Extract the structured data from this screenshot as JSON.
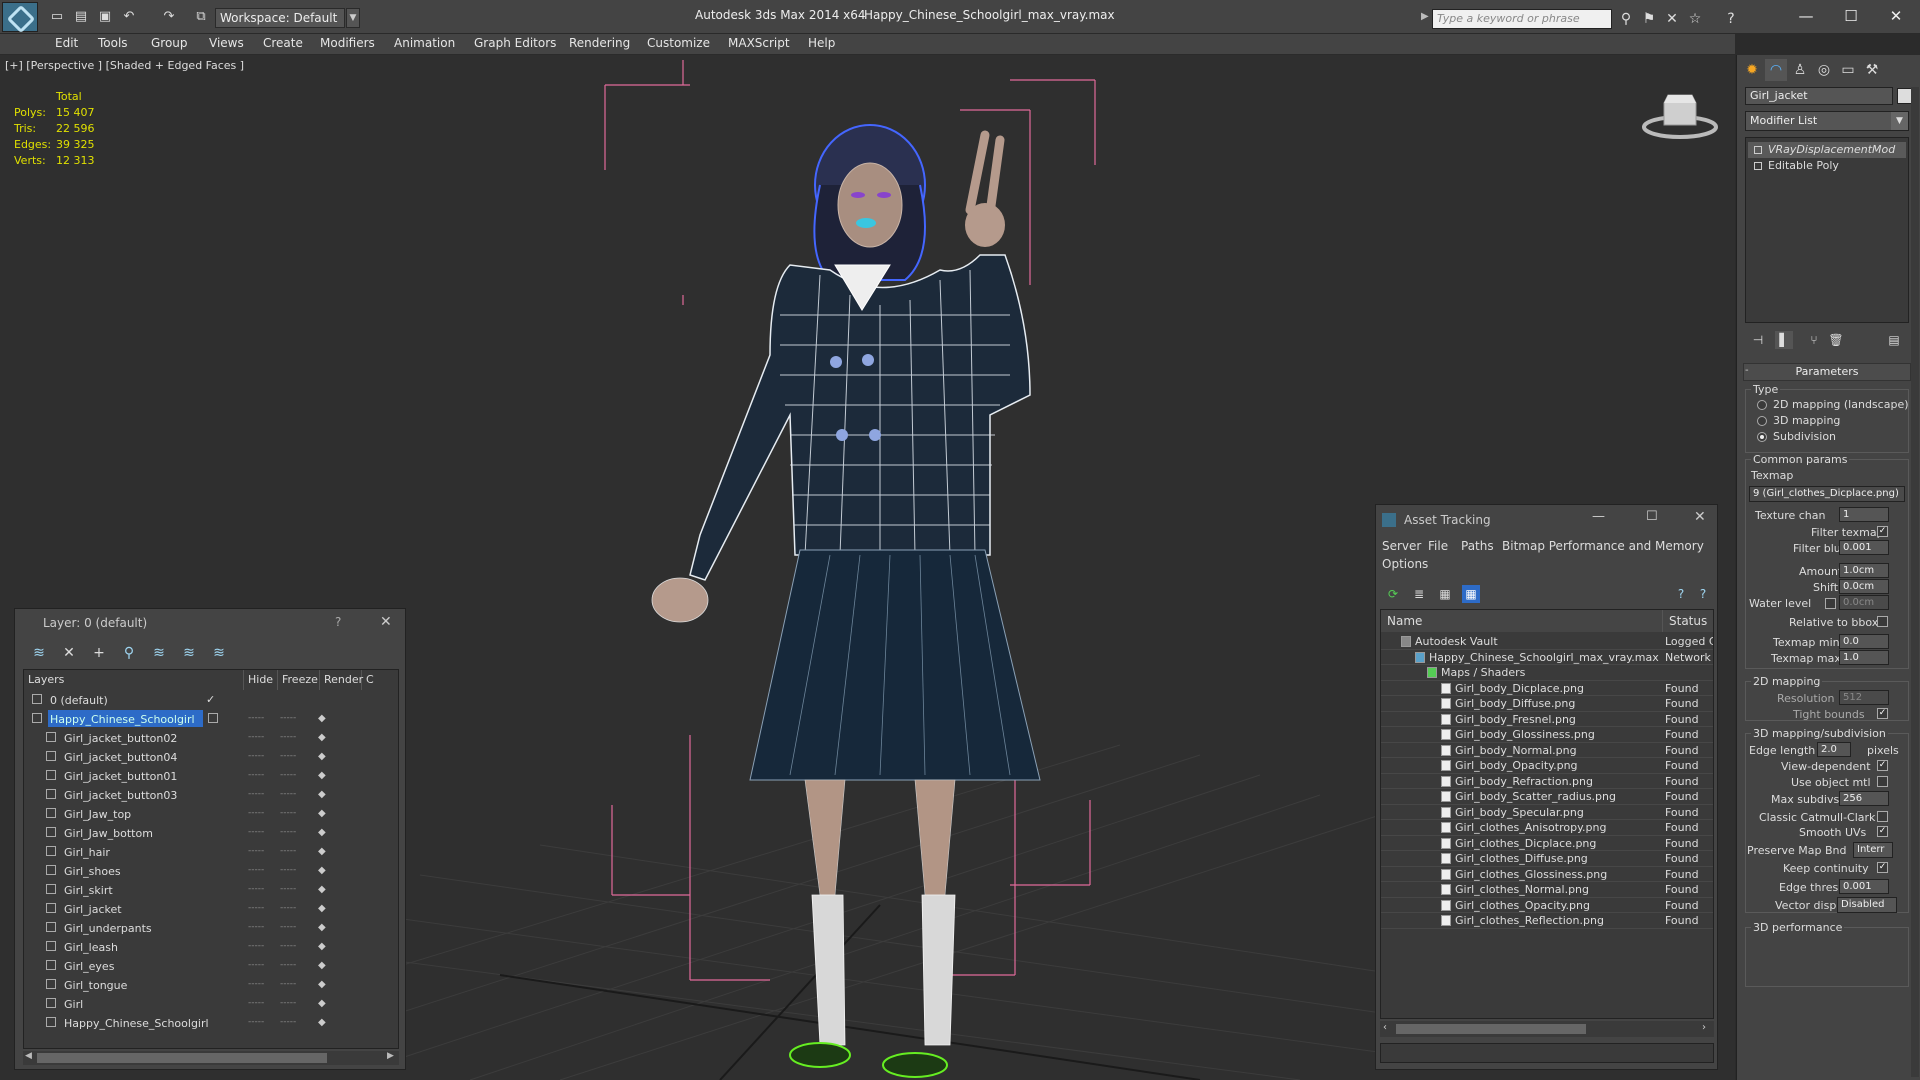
{
  "titlebar": {
    "app_title": "Autodesk 3ds Max  2014 x64",
    "file_title": "Happy_Chinese_Schoolgirl_max_vray.max",
    "workspace": "Workspace: Default",
    "search_placeholder": "Type a keyword or phrase"
  },
  "menu": [
    "Edit",
    "Tools",
    "Group",
    "Views",
    "Create",
    "Modifiers",
    "Animation",
    "Graph Editors",
    "Rendering",
    "Customize",
    "MAXScript",
    "Help"
  ],
  "viewport": {
    "label": "[+] [Perspective ] [Shaded + Edged Faces ]",
    "stats": {
      "header": "Total",
      "rows": [
        {
          "label": "Polys:",
          "value": "15 407"
        },
        {
          "label": "Tris:",
          "value": "22 596"
        },
        {
          "label": "Edges:",
          "value": "39 325"
        },
        {
          "label": "Verts:",
          "value": "12 313"
        }
      ]
    }
  },
  "layer_window": {
    "title": "Layer: 0 (default)",
    "help": "?",
    "columns": [
      "Layers",
      "Hide",
      "Freeze",
      "Render",
      "C"
    ],
    "rows": [
      {
        "name": "0 (default)",
        "level": 0,
        "active": true,
        "selected": false
      },
      {
        "name": "Happy_Chinese_Schoolgirl",
        "level": 0,
        "active": false,
        "selected": true
      },
      {
        "name": "Girl_jacket_button02",
        "level": 1,
        "active": false,
        "selected": false
      },
      {
        "name": "Girl_jacket_button04",
        "level": 1,
        "active": false,
        "selected": false
      },
      {
        "name": "Girl_jacket_button01",
        "level": 1,
        "active": false,
        "selected": false
      },
      {
        "name": "Girl_jacket_button03",
        "level": 1,
        "active": false,
        "selected": false
      },
      {
        "name": "Girl_Jaw_top",
        "level": 1,
        "active": false,
        "selected": false
      },
      {
        "name": "Girl_Jaw_bottom",
        "level": 1,
        "active": false,
        "selected": false
      },
      {
        "name": "Girl_hair",
        "level": 1,
        "active": false,
        "selected": false
      },
      {
        "name": "Girl_shoes",
        "level": 1,
        "active": false,
        "selected": false
      },
      {
        "name": "Girl_skirt",
        "level": 1,
        "active": false,
        "selected": false
      },
      {
        "name": "Girl_jacket",
        "level": 1,
        "active": false,
        "selected": false
      },
      {
        "name": "Girl_underpants",
        "level": 1,
        "active": false,
        "selected": false
      },
      {
        "name": "Girl_leash",
        "level": 1,
        "active": false,
        "selected": false
      },
      {
        "name": "Girl_eyes",
        "level": 1,
        "active": false,
        "selected": false
      },
      {
        "name": "Girl_tongue",
        "level": 1,
        "active": false,
        "selected": false
      },
      {
        "name": "Girl",
        "level": 1,
        "active": false,
        "selected": false
      },
      {
        "name": "Happy_Chinese_Schoolgirl",
        "level": 1,
        "active": false,
        "selected": false
      }
    ],
    "dash": "-----"
  },
  "asset_window": {
    "title": "Asset Tracking",
    "menu": [
      "Server",
      "File",
      "Paths",
      "Bitmap Performance and Memory",
      "Options"
    ],
    "columns": [
      "Name",
      "Status"
    ],
    "rows": [
      {
        "name": "Autodesk Vault",
        "status": "Logged C",
        "level": 0
      },
      {
        "name": "Happy_Chinese_Schoolgirl_max_vray.max",
        "status": "Network",
        "level": 1
      },
      {
        "name": "Maps / Shaders",
        "status": "",
        "level": 2
      },
      {
        "name": "Girl_body_Dicplace.png",
        "status": "Found",
        "level": 3
      },
      {
        "name": "Girl_body_Diffuse.png",
        "status": "Found",
        "level": 3
      },
      {
        "name": "Girl_body_Fresnel.png",
        "status": "Found",
        "level": 3
      },
      {
        "name": "Girl_body_Glossiness.png",
        "status": "Found",
        "level": 3
      },
      {
        "name": "Girl_body_Normal.png",
        "status": "Found",
        "level": 3
      },
      {
        "name": "Girl_body_Opacity.png",
        "status": "Found",
        "level": 3
      },
      {
        "name": "Girl_body_Refraction.png",
        "status": "Found",
        "level": 3
      },
      {
        "name": "Girl_body_Scatter_radius.png",
        "status": "Found",
        "level": 3
      },
      {
        "name": "Girl_body_Specular.png",
        "status": "Found",
        "level": 3
      },
      {
        "name": "Girl_clothes_Anisotropy.png",
        "status": "Found",
        "level": 3
      },
      {
        "name": "Girl_clothes_Dicplace.png",
        "status": "Found",
        "level": 3
      },
      {
        "name": "Girl_clothes_Diffuse.png",
        "status": "Found",
        "level": 3
      },
      {
        "name": "Girl_clothes_Glossiness.png",
        "status": "Found",
        "level": 3
      },
      {
        "name": "Girl_clothes_Normal.png",
        "status": "Found",
        "level": 3
      },
      {
        "name": "Girl_clothes_Opacity.png",
        "status": "Found",
        "level": 3
      },
      {
        "name": "Girl_clothes_Reflection.png",
        "status": "Found",
        "level": 3
      }
    ]
  },
  "command_panel": {
    "object_name": "Girl_jacket",
    "modifier_list": "Modifier List",
    "stack": [
      "VRayDisplacementMod",
      "Editable Poly"
    ],
    "rollout_title": "Parameters",
    "type_label": "Type",
    "type_options": [
      {
        "label": "2D mapping (landscape)",
        "checked": false
      },
      {
        "label": "3D mapping",
        "checked": false
      },
      {
        "label": "Subdivision",
        "checked": true
      }
    ],
    "common_params": "Common params",
    "texmap_label": "Texmap",
    "texmap_value": "9 (Girl_clothes_Dicplace.png)",
    "texture_chan_label": "Texture chan",
    "texture_chan": "1",
    "filter_texmap_label": "Filter texmap",
    "filter_blur_label": "Filter blur",
    "filter_blur": "0.001",
    "amount_label": "Amount",
    "amount": "1.0cm",
    "shift_label": "Shift",
    "shift": "0.0cm",
    "water_level_label": "Water level",
    "water_level": "0.0cm",
    "relative_bbox_label": "Relative to bbox",
    "texmap_min_label": "Texmap min",
    "texmap_min": "0.0",
    "texmap_max_label": "Texmap max",
    "texmap_max": "1.0",
    "mapping2d_label": "2D mapping",
    "resolution_label": "Resolution",
    "resolution": "512",
    "tight_bounds_label": "Tight bounds",
    "mapping3d_label": "3D mapping/subdivision",
    "edge_length_label": "Edge length",
    "edge_length": "2.0",
    "pixels_label": "pixels",
    "view_dependent_label": "View-dependent",
    "use_object_mtl_label": "Use object mtl",
    "max_subdivs_label": "Max subdivs",
    "max_subdivs": "256",
    "classic_catmull_label": "Classic Catmull-Clark",
    "smooth_uvs_label": "Smooth UVs",
    "preserve_map_label": "Preserve Map Bnd",
    "preserve_map": "Interr",
    "keep_continuity_label": "Keep continuity",
    "edge_thresh_label": "Edge thresh",
    "edge_thresh": "0.001",
    "vector_displ_label": "Vector displ",
    "vector_displ": "Disabled",
    "perf_label": "3D performance"
  }
}
